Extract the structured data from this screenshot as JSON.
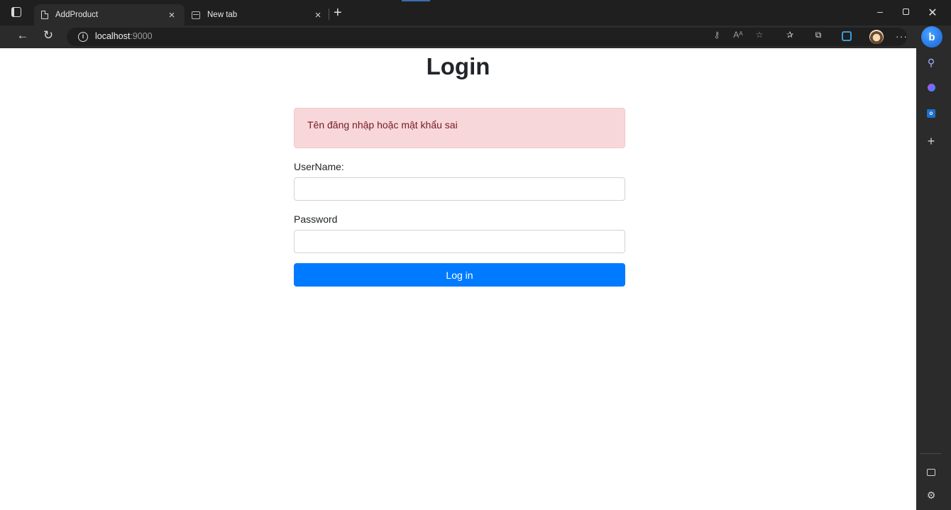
{
  "browser": {
    "tabs": [
      {
        "title": "AddProduct",
        "active": true
      },
      {
        "title": "New tab",
        "active": false
      }
    ],
    "tab_close_glyph": "×",
    "new_tab_glyph": "+",
    "window_controls": {
      "minimize": "–",
      "close": "✕"
    },
    "url_host": "localhost",
    "url_port": ":9000",
    "toolbar_icons": [
      "key-icon",
      "read-aloud-icon",
      "favorite-icon",
      "favorites-icon",
      "collections-icon",
      "edge-icon",
      "profile-avatar",
      "more-icon"
    ],
    "sidebar_icons": [
      "bing-icon",
      "search-icon",
      "copilot-icon",
      "outlook-icon",
      "add-icon",
      "panel-icon",
      "settings-icon"
    ]
  },
  "page": {
    "title": "Login",
    "alert": "Tên đăng nhập hoặc mật khẩu sai",
    "username_label": "UserName:",
    "username_value": "",
    "password_label": "Password",
    "password_value": "",
    "submit_label": "Log in"
  },
  "colors": {
    "primary": "#007bff",
    "alert_bg": "#f8d7da",
    "alert_text": "#721c24"
  }
}
